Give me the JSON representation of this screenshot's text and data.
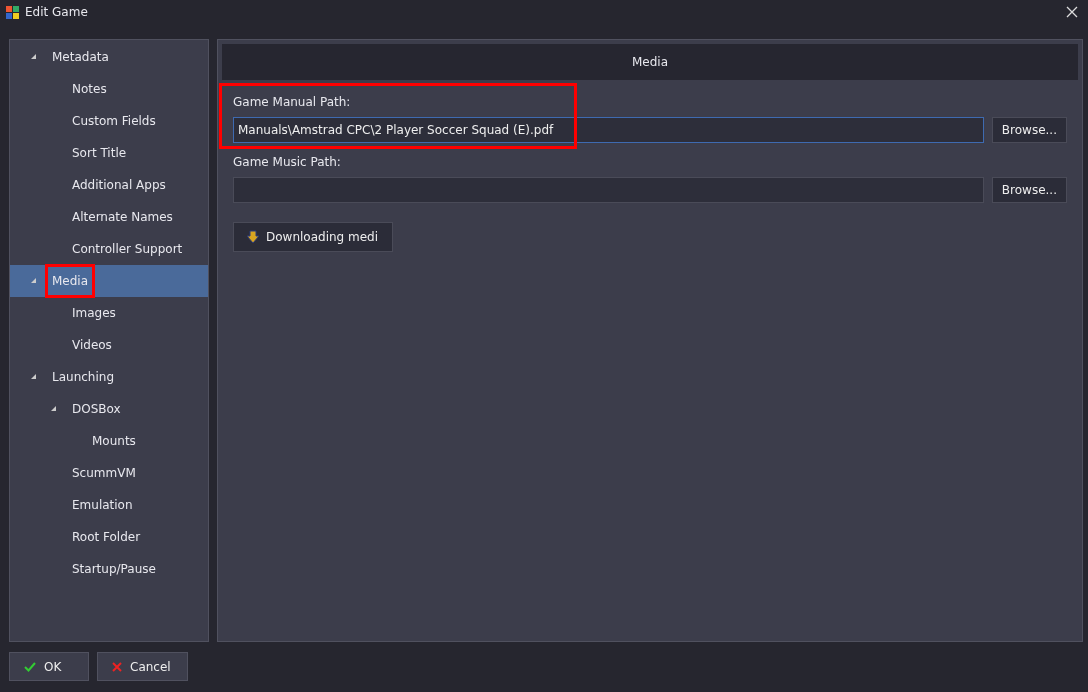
{
  "window": {
    "title": "Edit Game"
  },
  "sidebar": {
    "items": [
      {
        "label": "Metadata",
        "expanded": true,
        "selected": false,
        "highlighted": false,
        "children": [
          {
            "label": "Notes",
            "selected": false,
            "highlighted": false
          },
          {
            "label": "Custom Fields",
            "selected": false,
            "highlighted": false
          },
          {
            "label": "Sort Title",
            "selected": false,
            "highlighted": false
          },
          {
            "label": "Additional Apps",
            "selected": false,
            "highlighted": false
          },
          {
            "label": "Alternate Names",
            "selected": false,
            "highlighted": false
          },
          {
            "label": "Controller Support",
            "selected": false,
            "highlighted": false
          }
        ]
      },
      {
        "label": "Media",
        "expanded": true,
        "selected": true,
        "highlighted": true,
        "children": [
          {
            "label": "Images",
            "selected": false,
            "highlighted": false
          },
          {
            "label": "Videos",
            "selected": false,
            "highlighted": false
          }
        ]
      },
      {
        "label": "Launching",
        "expanded": true,
        "selected": false,
        "highlighted": false,
        "children": [
          {
            "label": "DOSBox",
            "expanded": true,
            "selected": false,
            "highlighted": false,
            "children": [
              {
                "label": "Mounts",
                "selected": false,
                "highlighted": false
              }
            ]
          },
          {
            "label": "ScummVM",
            "selected": false,
            "highlighted": false
          },
          {
            "label": "Emulation",
            "selected": false,
            "highlighted": false
          },
          {
            "label": "Root Folder",
            "selected": false,
            "highlighted": false
          },
          {
            "label": "Startup/Pause",
            "selected": false,
            "highlighted": false
          }
        ]
      }
    ]
  },
  "panel": {
    "title": "Media",
    "fields": [
      {
        "label": "Game Manual Path:",
        "value": "Manuals\\Amstrad CPC\\2 Player Soccer Squad (E).pdf",
        "focused": true,
        "highlighted": true,
        "button": "Browse..."
      },
      {
        "label": "Game Music Path:",
        "focused": false,
        "highlighted": false,
        "button": "Browse..."
      }
    ],
    "download_button": "Downloading medi"
  },
  "buttons": [
    {
      "label": "OK",
      "kind": "ok"
    },
    {
      "label": "Cancel",
      "kind": "cancel"
    }
  ]
}
